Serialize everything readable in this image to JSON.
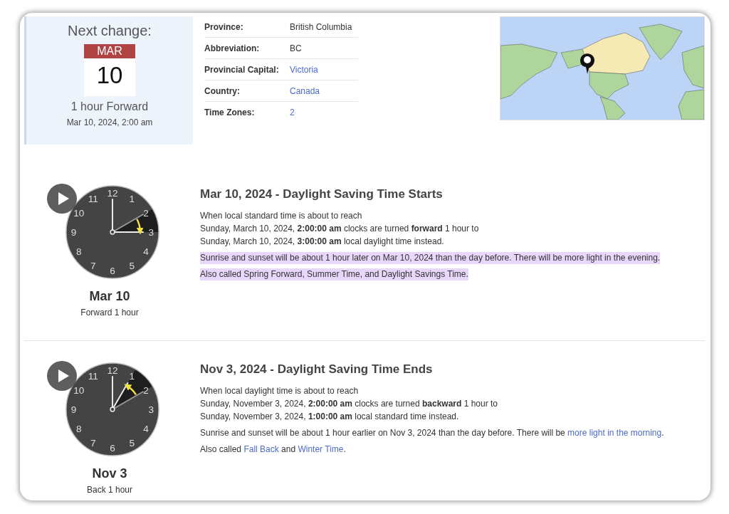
{
  "next_change": {
    "heading": "Next change:",
    "month": "MAR",
    "day": "10",
    "summary": "1 hour Forward",
    "datetime": "Mar 10, 2024, 2:00 am"
  },
  "facts": [
    {
      "label": "Province:",
      "value": "British Columbia",
      "link": false
    },
    {
      "label": "Abbreviation:",
      "value": "BC",
      "link": false
    },
    {
      "label": "Provincial Capital:",
      "value": "Victoria",
      "link": true
    },
    {
      "label": "Country:",
      "value": "Canada",
      "link": true
    },
    {
      "label": "Time Zones:",
      "value": "2",
      "link": true
    }
  ],
  "events": [
    {
      "kind": "forward",
      "dial": [
        "12",
        "1",
        "2",
        "3",
        "4",
        "5",
        "6",
        "7",
        "8",
        "9",
        "10",
        "11"
      ],
      "date": "Mar 10",
      "change": "Forward 1 hour",
      "title": "Mar 10, 2024 - Daylight Saving Time Starts",
      "lines": [
        "When local standard time is about to reach",
        "Sunday, March 10, 2024, **2:00:00 am** clocks are turned **forward** 1 hour to",
        "Sunday, March 10, 2024, **3:00:00 am** local daylight time instead."
      ],
      "notes": [
        {
          "highlighted": true,
          "parts": [
            {
              "text": "Sunrise and sunset will be about 1 hour later on Mar 10, 2024 than the day before. There will be more light in the evening.",
              "link": false
            }
          ]
        },
        {
          "highlighted": true,
          "parts": [
            {
              "text": "Also called Spring Forward, Summer Time, and Daylight Savings Time.",
              "link": false
            }
          ]
        }
      ]
    },
    {
      "kind": "back",
      "dial": [
        "12",
        "1",
        "2",
        "3",
        "4",
        "5",
        "6",
        "7",
        "8",
        "9",
        "10",
        "11"
      ],
      "date": "Nov 3",
      "change": "Back 1 hour",
      "title": "Nov 3, 2024 - Daylight Saving Time Ends",
      "lines": [
        "When local daylight time is about to reach",
        "Sunday, November 3, 2024, **2:00:00 am** clocks are turned **backward** 1 hour to",
        "Sunday, November 3, 2024, **1:00:00 am** local standard time instead."
      ],
      "notes": [
        {
          "highlighted": false,
          "parts": [
            {
              "text": "Sunrise and sunset will be about 1 hour earlier on Nov 3, 2024 than the day before. There will be ",
              "link": false
            },
            {
              "text": "more light in the morning",
              "link": true
            },
            {
              "text": ".",
              "link": false
            }
          ]
        },
        {
          "highlighted": false,
          "parts": [
            {
              "text": "Also called ",
              "link": false
            },
            {
              "text": "Fall Back",
              "link": true
            },
            {
              "text": " and ",
              "link": false
            },
            {
              "text": "Winter Time",
              "link": true
            },
            {
              "text": ".",
              "link": false
            }
          ]
        }
      ]
    }
  ]
}
